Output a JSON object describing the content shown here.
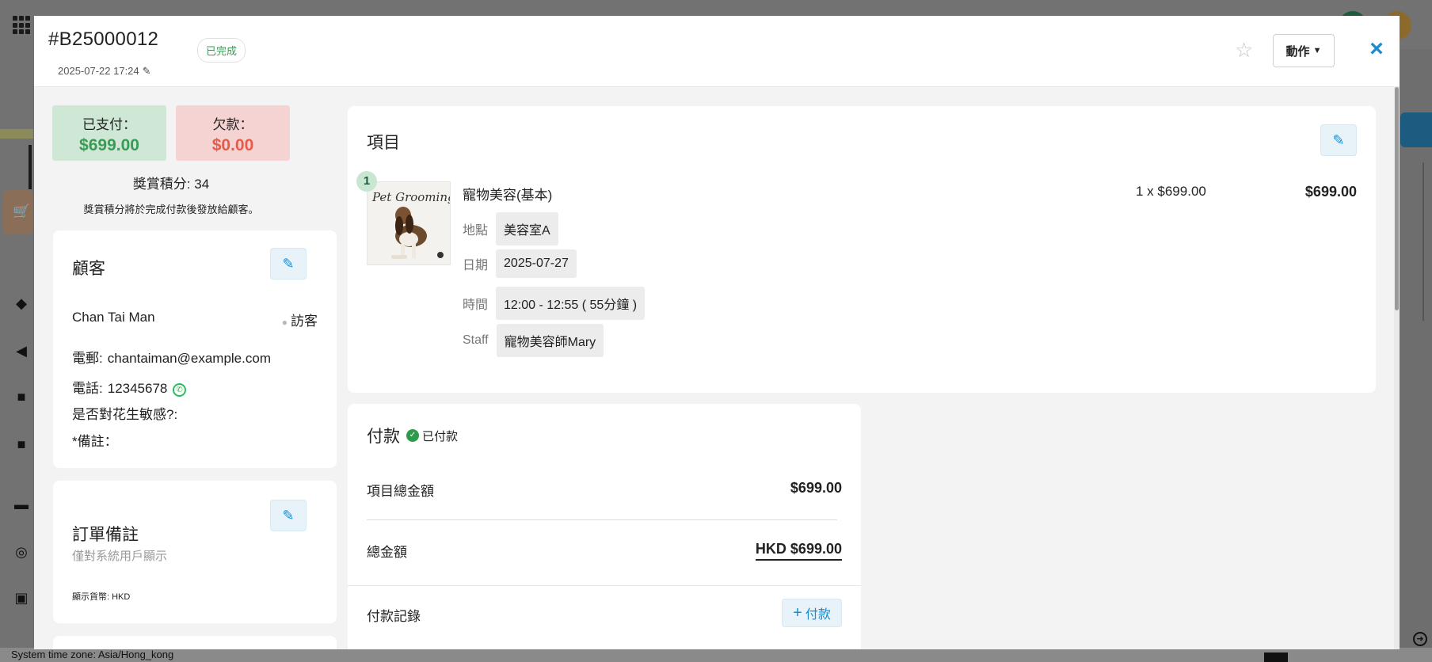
{
  "background": {
    "footer_text": "System time zone: Asia/Hong_kong"
  },
  "header": {
    "order_id": "#B25000012",
    "order_date": "2025-07-22 17:24",
    "status": "已完成",
    "action_label": "動作"
  },
  "summary": {
    "paid_label": "已支付：",
    "paid_amount": "$699.00",
    "due_label": "欠款：",
    "due_amount": "$0.00",
    "points_text": "獎賞積分: 34",
    "points_note": "獎賞積分將於完成付款後發放給顧客。"
  },
  "customer": {
    "title": "顧客",
    "name": "Chan Tai Man",
    "type": "訪客",
    "email_label": "電郵:",
    "email": "chantaiman@example.com",
    "phone_label": "電話:",
    "phone": "12345678",
    "allergy_label": "是否對花生敏感?:",
    "remark_label": "*備註："
  },
  "order_note": {
    "title": "訂單備註",
    "subtitle": "僅對系統用戶顯示",
    "currency_text": "顯示貨幣: HKD"
  },
  "items": {
    "title": "項目",
    "list": [
      {
        "index": "1",
        "thumb_text": "Pet Grooming",
        "name": "寵物美容(基本)",
        "qty_price": "1 x $699.00",
        "total": "$699.00",
        "location_label": "地點",
        "location": "美容室A",
        "date_label": "日期",
        "date": "2025-07-27",
        "time_label": "時間",
        "time": "12:00 - 12:55 ( 55分鐘 )",
        "staff_label": "Staff",
        "staff": "寵物美容師Mary"
      }
    ]
  },
  "payment": {
    "title": "付款",
    "status": "已付款",
    "subtotal_label": "項目總金額",
    "subtotal": "$699.00",
    "total_label": "總金額",
    "total": "HKD $699.00",
    "records_label": "付款記錄",
    "add_label": "付款"
  },
  "colors": {
    "accent": "#1a8bd0",
    "paid_green": "#3a9b55",
    "due_red": "#e65c4b"
  }
}
